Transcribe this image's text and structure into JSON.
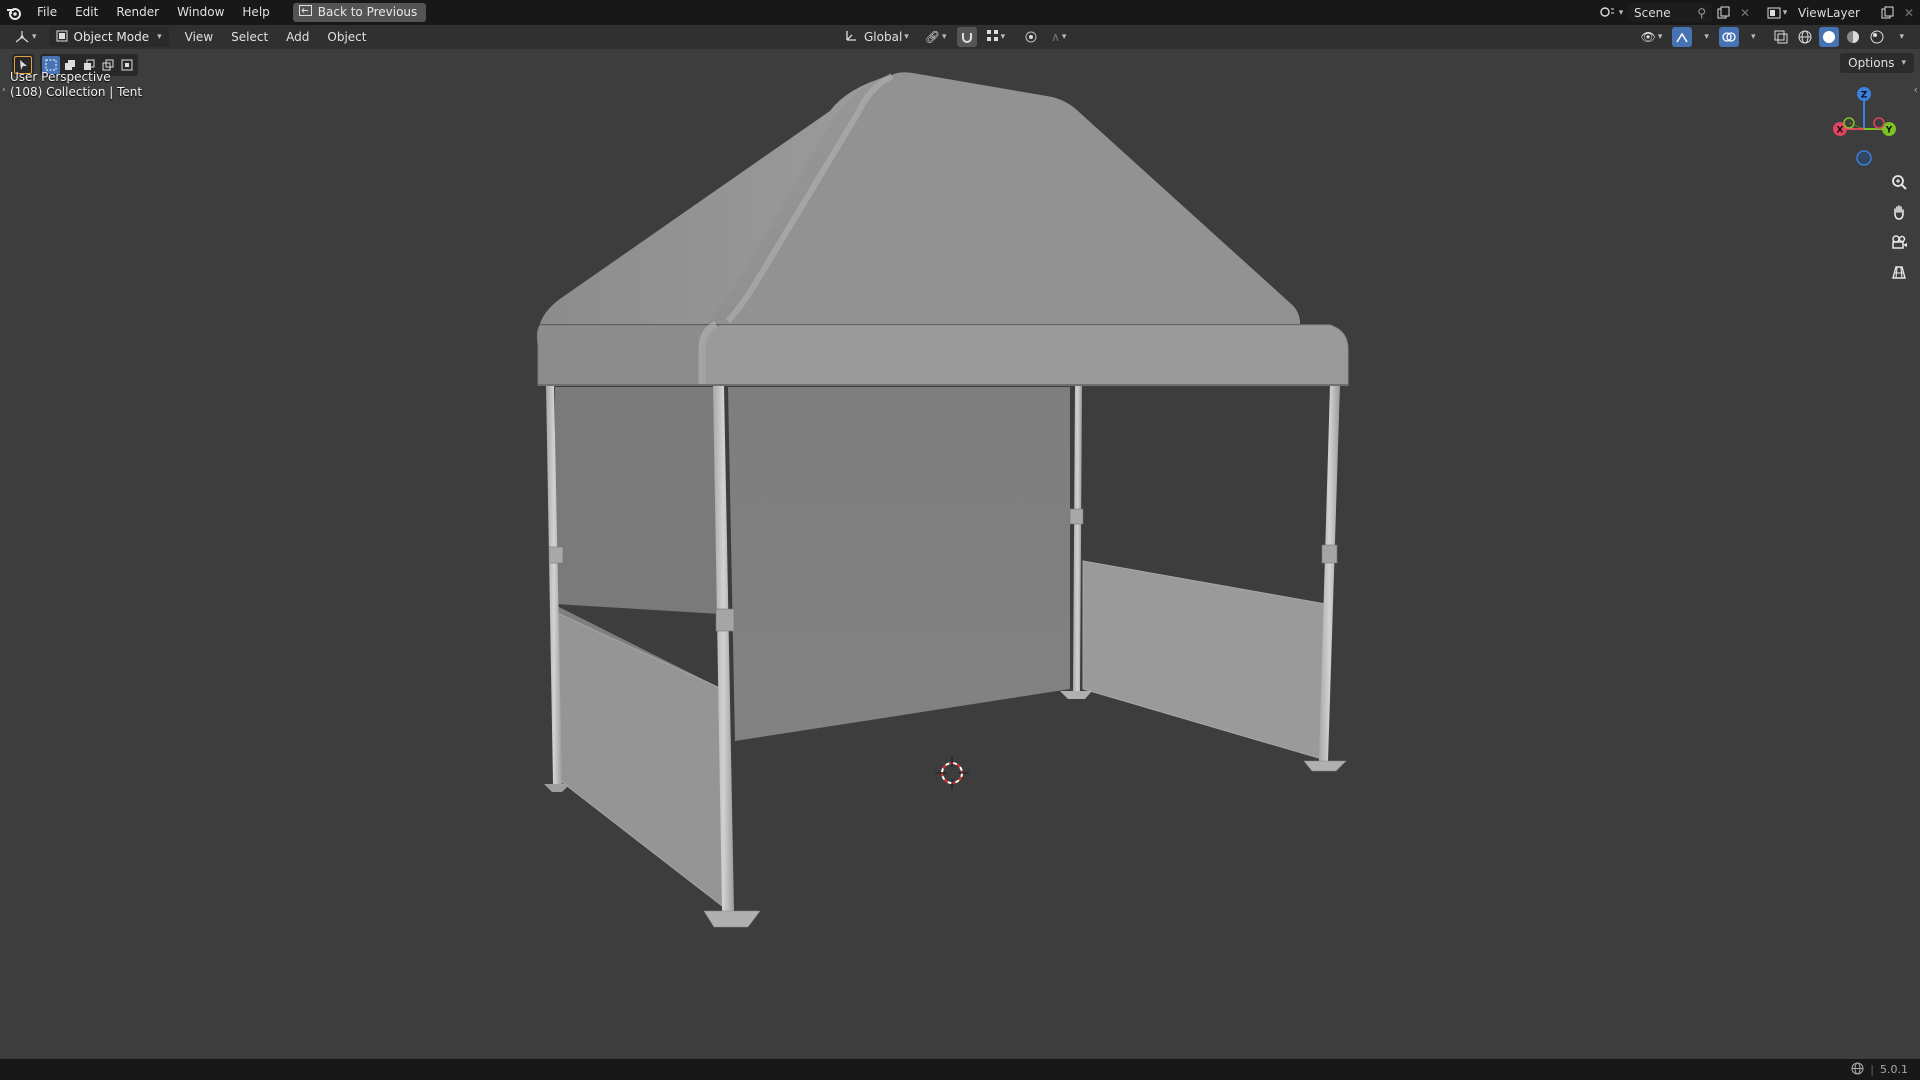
{
  "menu": {
    "items": [
      "File",
      "Edit",
      "Render",
      "Window",
      "Help"
    ],
    "back_label": "Back to Previous"
  },
  "scene": {
    "name": "Scene"
  },
  "view_layer": {
    "name": "ViewLayer"
  },
  "header": {
    "mode": "Object Mode",
    "menus": [
      "View",
      "Select",
      "Add",
      "Object"
    ],
    "transform_orientation": "Global"
  },
  "viewport": {
    "perspective_label": "User Perspective",
    "collection_label": "(108) Collection | Tent",
    "options_label": "Options",
    "gizmo": {
      "x": "X",
      "y": "Y",
      "z": "Z"
    }
  },
  "status": {
    "version": "5.0.1"
  },
  "colors": {
    "accent": "#4772b3",
    "axis_x": "#e04460",
    "axis_y": "#7bc224",
    "axis_z": "#3a80e0"
  }
}
